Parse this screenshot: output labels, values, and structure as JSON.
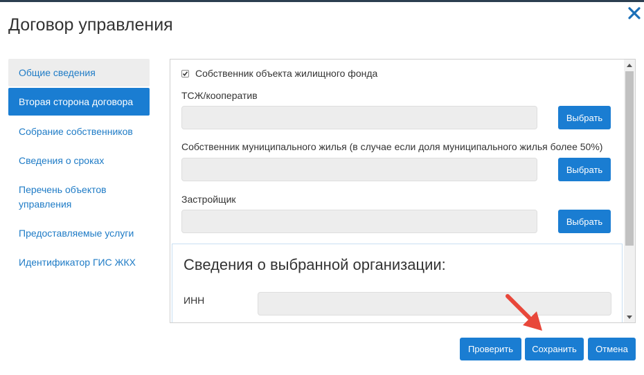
{
  "dialog": {
    "title": "Договор управления",
    "close_icon": "close-icon"
  },
  "sidebar": {
    "items": [
      {
        "label": "Общие сведения"
      },
      {
        "label": "Вторая сторона договора"
      },
      {
        "label": "Собрание собственников"
      },
      {
        "label": "Сведения о сроках"
      },
      {
        "label": "Перечень объектов управления"
      },
      {
        "label": "Предоставляемые услуги"
      },
      {
        "label": "Идентификатор ГИС ЖКХ"
      }
    ],
    "active_index": 1
  },
  "form": {
    "owner_checkbox": {
      "label": "Собственник объекта жилищного фонда",
      "checked": true
    },
    "hoa": {
      "label": "ТСЖ/кооператив",
      "value": "",
      "button": "Выбрать"
    },
    "municipal_owner": {
      "label": "Собственник муниципального жилья (в случае если доля муниципального жилья более 50%)",
      "value": "",
      "button": "Выбрать"
    },
    "developer": {
      "label": "Застройщик",
      "value": "",
      "button": "Выбрать"
    },
    "org_info": {
      "title": "Сведения о выбранной организации:",
      "inn_label": "ИНН",
      "inn_value": ""
    }
  },
  "footer": {
    "check": "Проверить",
    "save": "Сохранить",
    "cancel": "Отмена"
  },
  "colors": {
    "primary": "#1a7dd2",
    "link": "#1e7bc6",
    "annotation_arrow": "#e8473a"
  }
}
